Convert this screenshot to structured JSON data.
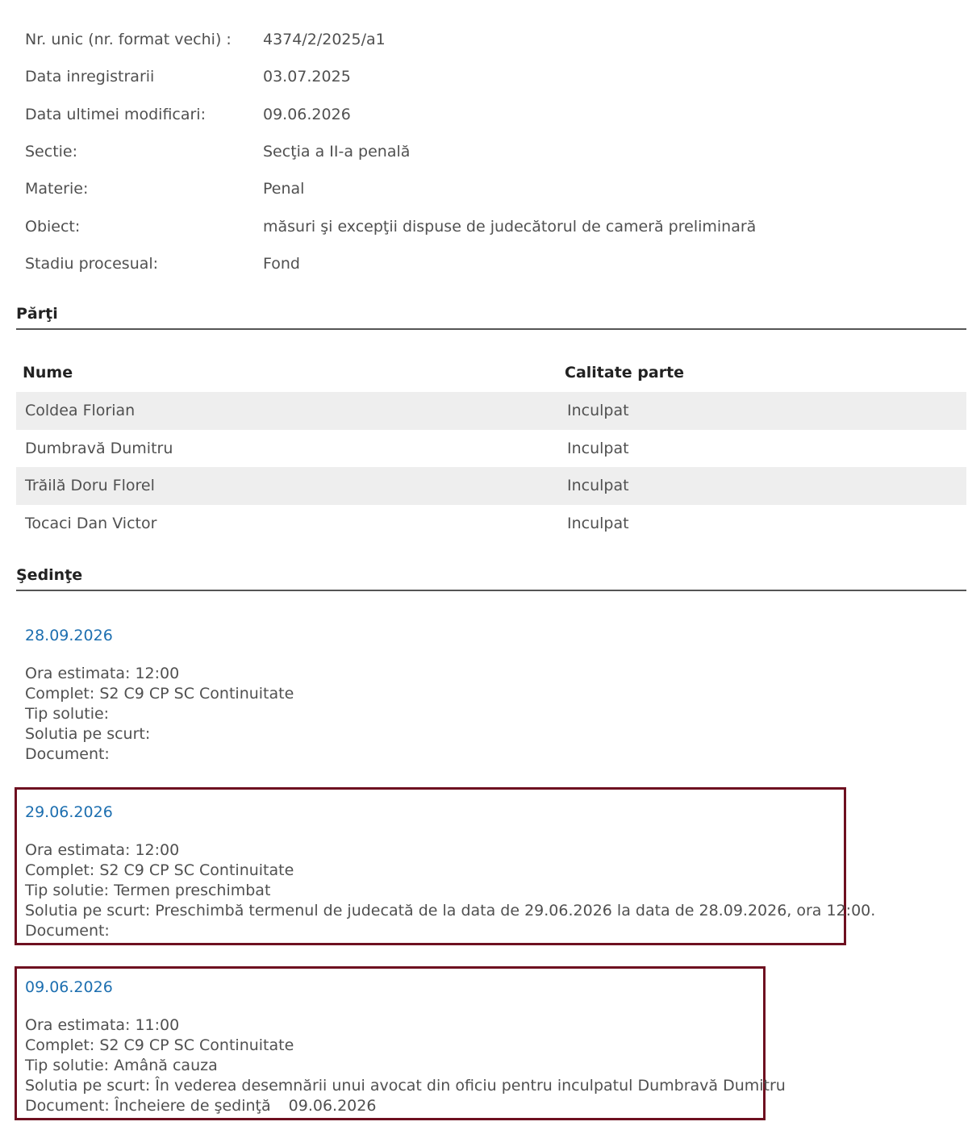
{
  "info": {
    "rows": [
      {
        "label": "Nr. unic (nr. format vechi) :",
        "value": "4374/2/2025/a1"
      },
      {
        "label": "Data inregistrarii",
        "value": "03.07.2025"
      },
      {
        "label": "Data ultimei modificari:",
        "value": "09.06.2026"
      },
      {
        "label": "Sectie:",
        "value": "Secţia a II-a penală"
      },
      {
        "label": "Materie:",
        "value": "Penal"
      },
      {
        "label": "Obiect:",
        "value": "măsuri şi excepţii dispuse de judecătorul de cameră preliminară"
      },
      {
        "label": "Stadiu procesual:",
        "value": "Fond"
      }
    ]
  },
  "parti": {
    "title": "Părţi",
    "headers": {
      "name": "Nume",
      "role": "Calitate parte"
    },
    "rows": [
      {
        "name": "Coldea Florian",
        "role": "Inculpat"
      },
      {
        "name": "Dumbravă Dumitru",
        "role": "Inculpat"
      },
      {
        "name": "Trăilă Doru Florel",
        "role": "Inculpat"
      },
      {
        "name": "Tocaci Dan Victor",
        "role": "Inculpat"
      }
    ]
  },
  "sedinte": {
    "title": "Şedinţe",
    "items": [
      {
        "date": "28.09.2026",
        "ora": "Ora estimata: 12:00",
        "complet": "Complet: S2 C9 CP SC Continuitate",
        "tip": "Tip solutie:",
        "solutia": "Solutia pe scurt:",
        "document": "Document:",
        "document_date": ""
      },
      {
        "date": "29.06.2026",
        "ora": "Ora estimata: 12:00",
        "complet": "Complet: S2 C9 CP SC Continuitate",
        "tip": "Tip solutie: Termen preschimbat",
        "solutia": "Solutia pe scurt: Preschimbă termenul de judecată de la data de 29.06.2026 la data de 28.09.2026, ora 12:00.",
        "document": "Document:",
        "document_date": ""
      },
      {
        "date": "09.06.2026",
        "ora": "Ora estimata: 11:00",
        "complet": "Complet: S2 C9 CP SC Continuitate",
        "tip": "Tip solutie: Amână cauza",
        "solutia": "Solutia pe scurt: În vederea desemnării unui avocat din oficiu pentru inculpatul Dumbravă Dumitru",
        "document": "Document: Încheiere de şedinţă",
        "document_date": "09.06.2026"
      }
    ]
  },
  "colors": {
    "link": "#1d6fb0",
    "highlight_border": "#6e1020",
    "row_stripe": "#eeeeee"
  }
}
